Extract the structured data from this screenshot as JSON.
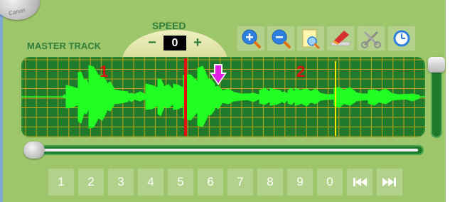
{
  "logo": {
    "text": "Canon"
  },
  "track": {
    "label": "MASTER TRACK"
  },
  "speed": {
    "label": "SPEED",
    "minus": "−",
    "plus": "+",
    "value": "0"
  },
  "toolbar": {
    "tools": [
      {
        "name": "zoom-in-icon"
      },
      {
        "name": "zoom-out-icon"
      },
      {
        "name": "zoom-fit-icon"
      },
      {
        "name": "erase-icon"
      },
      {
        "name": "cut-icon"
      },
      {
        "name": "clock-icon"
      }
    ]
  },
  "waveform": {
    "markers": [
      {
        "label": "1"
      },
      {
        "label": "2"
      }
    ],
    "playhead_color": "#e01010",
    "marker_color": "#ffe700",
    "wave_color": "#22ff22",
    "drop_arrow_color": "#e020e0"
  },
  "numpad": {
    "keys": [
      "1",
      "2",
      "3",
      "4",
      "5",
      "6",
      "7",
      "8",
      "9",
      "0"
    ],
    "prev_label": "previous-icon",
    "next_label": "next-icon"
  },
  "colors": {
    "panel": "#9dc66b",
    "label_green": "#2f7d3a",
    "wave_bg": "#1f7a2c"
  }
}
